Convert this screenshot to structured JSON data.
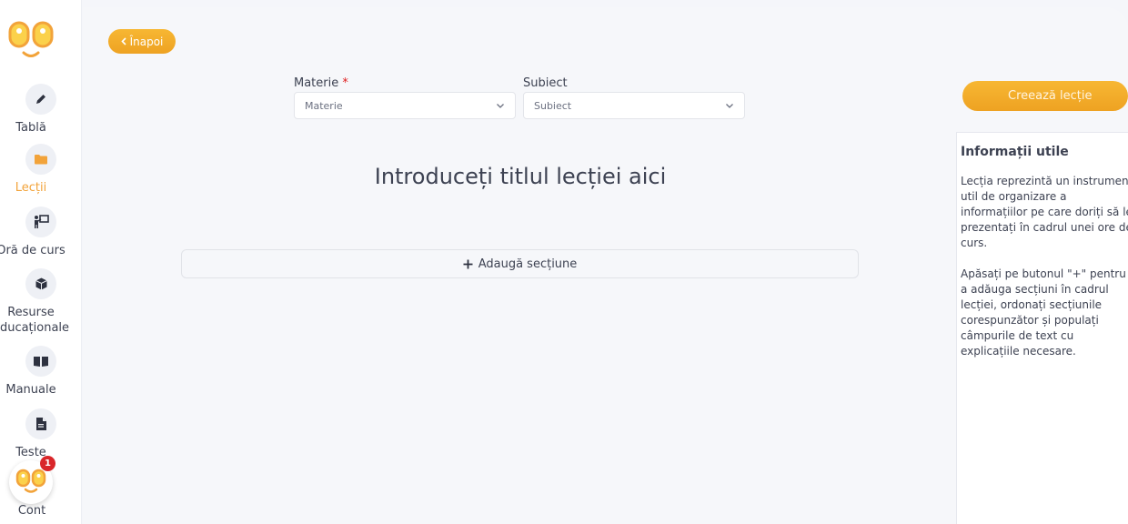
{
  "sidebar": {
    "items": [
      {
        "label": "Tablă",
        "icon": "pencil-icon"
      },
      {
        "label": "Lecții",
        "icon": "folder-icon"
      },
      {
        "label": "Oră de curs",
        "icon": "teacher-board-icon"
      },
      {
        "label_line1": "Resurse",
        "label_line2": "educaționale",
        "icon": "cube-icon"
      },
      {
        "label": "Manuale",
        "icon": "book-icon"
      },
      {
        "label": "Teste",
        "icon": "document-icon"
      }
    ],
    "account": {
      "label": "Cont",
      "badge": "1"
    }
  },
  "toolbar": {
    "back_label": "Înapoi"
  },
  "form": {
    "materie": {
      "label": "Materie",
      "required_mark": "*",
      "placeholder": "Materie"
    },
    "subiect": {
      "label": "Subiect",
      "placeholder": "Subiect"
    },
    "title_placeholder": "Introduceți titlul lecției aici",
    "add_section_label": "Adaugă secțiune"
  },
  "actions": {
    "create_label": "Creează lecție"
  },
  "info": {
    "title": "Informații utile",
    "paragraph1": "Lecția reprezintă un instrument util de organizare a informațiilor pe care doriți să le prezentați în cadrul unei ore de curs.",
    "paragraph2": "Apăsați pe butonul \"+\" pentru a adăuga secțiuni în cadrul lecției, ordonați secțiunile corespunzător și populați câmpurile de text cu explicațiile necesare."
  },
  "colors": {
    "accent": "#f2a33a",
    "badge": "#d9262a",
    "text": "#3d4252"
  }
}
